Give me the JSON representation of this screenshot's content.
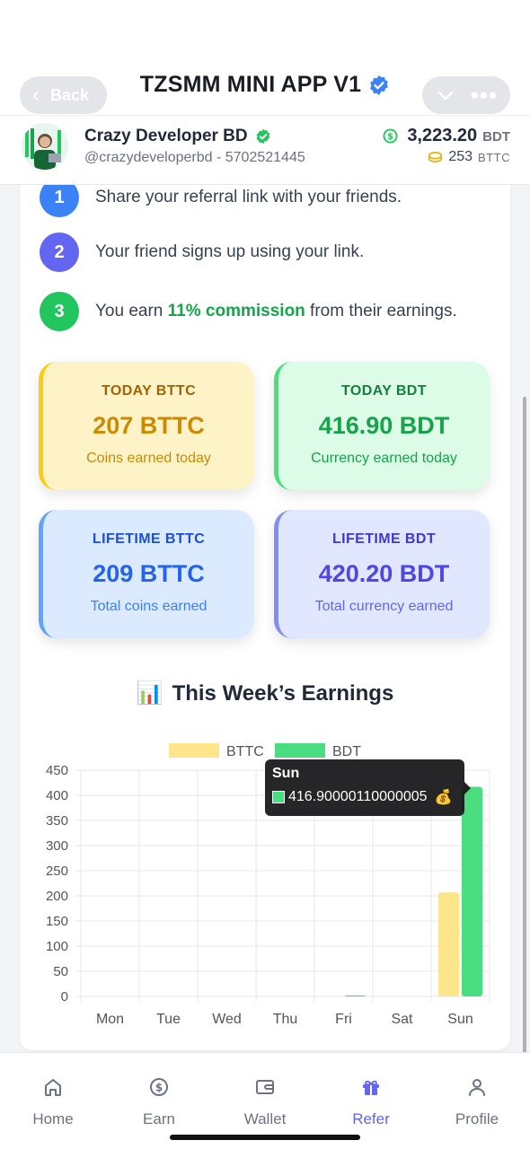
{
  "telegram": {
    "back_label": "Back",
    "title": "TZSMM MINI APP V1"
  },
  "profile": {
    "name": "Crazy Developer BD",
    "handle": "@crazydeveloperbd - 5702521445",
    "bdt_balance": "3,223.20",
    "bdt_unit": "BDT",
    "bttc_balance": "253",
    "bttc_unit": "BTTC"
  },
  "steps": [
    {
      "num": "1",
      "text": "Share your referral link with your friends."
    },
    {
      "num": "2",
      "text": "Your friend signs up using your link."
    },
    {
      "num": "3",
      "text_before": "You earn ",
      "highlight": "11% commission",
      "text_after": " from their earnings."
    }
  ],
  "stats": {
    "today_bttc": {
      "label": "TODAY BTTC",
      "value": "207 BTTC",
      "sub": "Coins earned today"
    },
    "today_bdt": {
      "label": "TODAY BDT",
      "value": "416.90 BDT",
      "sub": "Currency earned today"
    },
    "lifetime_bttc": {
      "label": "LIFETIME BTTC",
      "value": "209 BTTC",
      "sub": "Total coins earned"
    },
    "lifetime_bdt": {
      "label": "LIFETIME BDT",
      "value": "420.20 BDT",
      "sub": "Total currency earned"
    }
  },
  "chart_section": {
    "emoji": "📊",
    "title": "This Week’s Earnings"
  },
  "tooltip": {
    "title": "Sun",
    "value": "416.90000110000005",
    "emoji": "💰"
  },
  "chart_data": {
    "type": "bar",
    "categories": [
      "Mon",
      "Tue",
      "Wed",
      "Thu",
      "Fri",
      "Sat",
      "Sun"
    ],
    "series": [
      {
        "name": "BTTC",
        "color": "#fde68a",
        "values": [
          0,
          0,
          0,
          0,
          0,
          0,
          207
        ]
      },
      {
        "name": "BDT",
        "color": "#4ade80",
        "values": [
          0,
          0,
          0,
          0,
          2,
          0,
          416.9
        ]
      }
    ],
    "ylim": [
      0,
      450
    ],
    "yticks": [
      0,
      50,
      100,
      150,
      200,
      250,
      300,
      350,
      400,
      450
    ],
    "grid": true,
    "legend": "top"
  },
  "nav": {
    "items": [
      {
        "label": "Home",
        "icon": "home-icon"
      },
      {
        "label": "Earn",
        "icon": "dollar-icon"
      },
      {
        "label": "Wallet",
        "icon": "wallet-icon"
      },
      {
        "label": "Refer",
        "icon": "gift-icon",
        "active": true
      },
      {
        "label": "Profile",
        "icon": "user-icon"
      }
    ]
  }
}
